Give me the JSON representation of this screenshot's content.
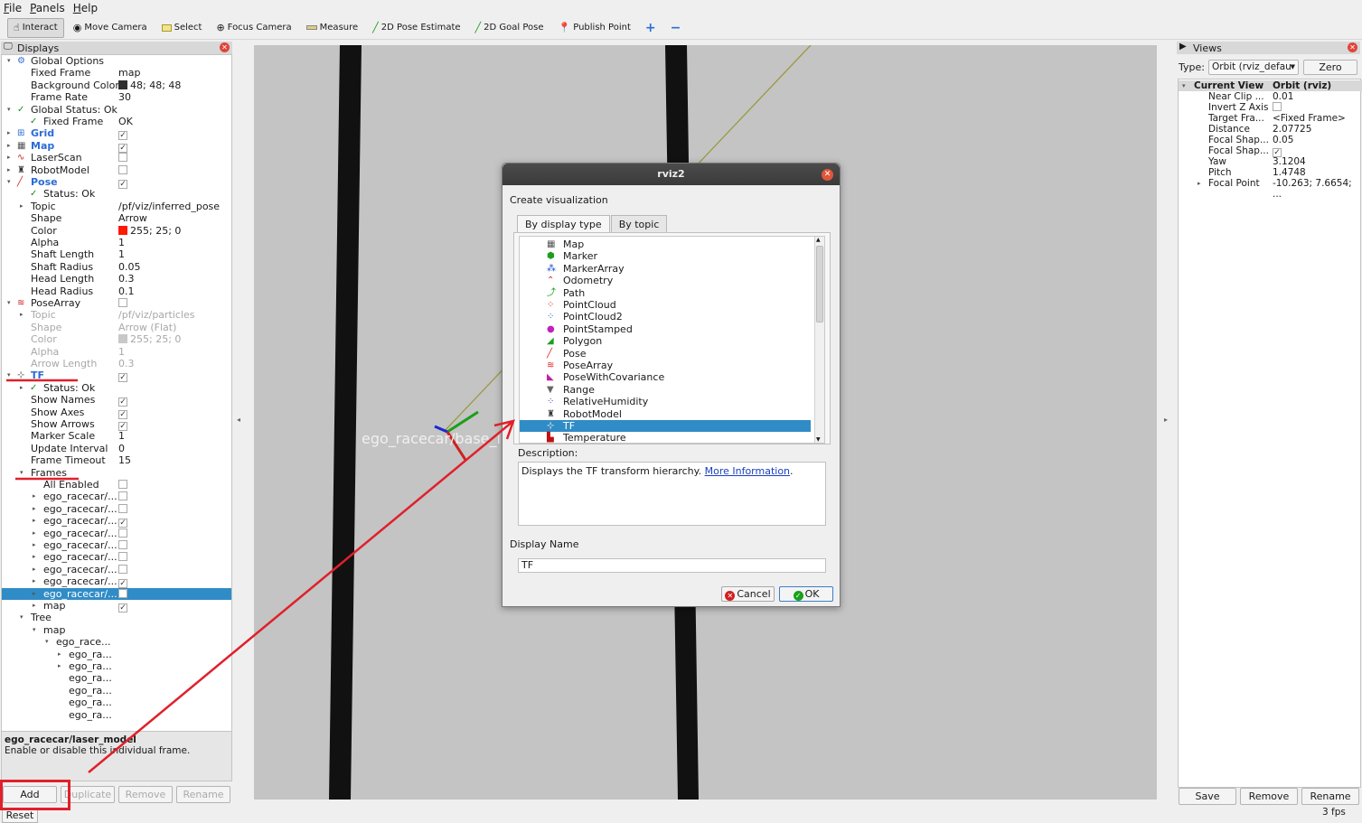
{
  "menubar": [
    "File",
    "Panels",
    "Help"
  ],
  "toolbar": [
    {
      "label": "Interact",
      "icon": "hand-icon",
      "active": true
    },
    {
      "label": "Move Camera",
      "icon": "camera-icon"
    },
    {
      "label": "Select",
      "icon": "select-icon"
    },
    {
      "label": "Focus Camera",
      "icon": "focus-icon"
    },
    {
      "label": "Measure",
      "icon": "ruler-icon"
    },
    {
      "label": "2D Pose Estimate",
      "icon": "green-arrow-icon"
    },
    {
      "label": "2D Goal Pose",
      "icon": "green-arrow-icon"
    },
    {
      "label": "Publish Point",
      "icon": "pin-icon"
    },
    {
      "label": "+",
      "icon": "plus-icon"
    },
    {
      "label": "−",
      "icon": "minus-icon"
    }
  ],
  "displays": {
    "title": "Displays",
    "rows": [
      {
        "d": 0,
        "exp": "v",
        "name": "Global Options",
        "icon": "gear-icon"
      },
      {
        "d": 1,
        "name": "Fixed Frame",
        "val": "map"
      },
      {
        "d": 1,
        "name": "Background Color",
        "val": "48; 48; 48",
        "swatch": "#303030"
      },
      {
        "d": 1,
        "name": "Frame Rate",
        "val": "30"
      },
      {
        "d": 0,
        "exp": "v",
        "name": "Global Status: Ok",
        "icon": "check-icon"
      },
      {
        "d": 1,
        "name": "Fixed Frame",
        "val": "OK",
        "icon": "check-icon"
      },
      {
        "d": 0,
        "exp": ">",
        "name": "Grid",
        "blue": true,
        "chk": true,
        "icon": "grid-icon"
      },
      {
        "d": 0,
        "exp": ">",
        "name": "Map",
        "blue": true,
        "chk": true,
        "icon": "map-icon"
      },
      {
        "d": 0,
        "exp": ">",
        "name": "LaserScan",
        "chk": false,
        "icon": "laserscan-icon"
      },
      {
        "d": 0,
        "exp": ">",
        "name": "RobotModel",
        "chk": false,
        "icon": "robot-icon"
      },
      {
        "d": 0,
        "exp": "v",
        "name": "Pose",
        "blue": true,
        "chk": true,
        "icon": "pose-icon"
      },
      {
        "d": 1,
        "name": "Status: Ok",
        "icon": "check-icon"
      },
      {
        "d": 1,
        "exp": ">",
        "name": "Topic",
        "val": "/pf/viz/inferred_pose"
      },
      {
        "d": 1,
        "name": "Shape",
        "val": "Arrow"
      },
      {
        "d": 1,
        "name": "Color",
        "val": "255; 25; 0",
        "swatch": "#ff1900"
      },
      {
        "d": 1,
        "name": "Alpha",
        "val": "1"
      },
      {
        "d": 1,
        "name": "Shaft Length",
        "val": "1"
      },
      {
        "d": 1,
        "name": "Shaft Radius",
        "val": "0.05"
      },
      {
        "d": 1,
        "name": "Head Length",
        "val": "0.3"
      },
      {
        "d": 1,
        "name": "Head Radius",
        "val": "0.1"
      },
      {
        "d": 0,
        "exp": "v",
        "name": "PoseArray",
        "chk": false,
        "icon": "posearray-icon"
      },
      {
        "d": 1,
        "exp": ">",
        "name": "Topic",
        "val": "/pf/viz/particles",
        "grey": true
      },
      {
        "d": 1,
        "name": "Shape",
        "val": "Arrow (Flat)",
        "grey": true
      },
      {
        "d": 1,
        "name": "Color",
        "val": "255; 25; 0",
        "swatch": "#c8c8c8",
        "grey": true
      },
      {
        "d": 1,
        "name": "Alpha",
        "val": "1",
        "grey": true
      },
      {
        "d": 1,
        "name": "Arrow Length",
        "val": "0.3",
        "grey": true
      },
      {
        "d": 0,
        "exp": "v",
        "name": "TF",
        "blue": true,
        "chk": true,
        "icon": "tf-icon"
      },
      {
        "d": 1,
        "exp": ">",
        "name": "Status: Ok",
        "icon": "check-icon"
      },
      {
        "d": 1,
        "name": "Show Names",
        "chk": true
      },
      {
        "d": 1,
        "name": "Show Axes",
        "chk": true
      },
      {
        "d": 1,
        "name": "Show Arrows",
        "chk": true
      },
      {
        "d": 1,
        "name": "Marker Scale",
        "val": "1"
      },
      {
        "d": 1,
        "name": "Update Interval",
        "val": "0"
      },
      {
        "d": 1,
        "name": "Frame Timeout",
        "val": "15"
      },
      {
        "d": 1,
        "exp": "v",
        "name": "Frames"
      },
      {
        "d": 2,
        "name": "All Enabled",
        "chk": false
      },
      {
        "d": 2,
        "exp": ">",
        "name": "ego_racecar/...",
        "chk": false
      },
      {
        "d": 2,
        "exp": ">",
        "name": "ego_racecar/...",
        "chk": false
      },
      {
        "d": 2,
        "exp": ">",
        "name": "ego_racecar/...",
        "chk": true
      },
      {
        "d": 2,
        "exp": ">",
        "name": "ego_racecar/...",
        "chk": false
      },
      {
        "d": 2,
        "exp": ">",
        "name": "ego_racecar/...",
        "chk": false
      },
      {
        "d": 2,
        "exp": ">",
        "name": "ego_racecar/...",
        "chk": false
      },
      {
        "d": 2,
        "exp": ">",
        "name": "ego_racecar/...",
        "chk": false
      },
      {
        "d": 2,
        "exp": ">",
        "name": "ego_racecar/...",
        "chk": true
      },
      {
        "d": 2,
        "exp": ">",
        "name": "ego_racecar/...",
        "chk": false,
        "sel": true
      },
      {
        "d": 2,
        "exp": ">",
        "name": "map",
        "chk": true
      },
      {
        "d": 1,
        "exp": "v",
        "name": "Tree"
      },
      {
        "d": 2,
        "exp": "v",
        "name": "map"
      },
      {
        "d": 3,
        "exp": "v",
        "name": "ego_race..."
      },
      {
        "d": 4,
        "exp": ">",
        "name": "ego_ra..."
      },
      {
        "d": 4,
        "exp": ">",
        "name": "ego_ra..."
      },
      {
        "d": 4,
        "name": "ego_ra..."
      },
      {
        "d": 4,
        "name": "ego_ra..."
      },
      {
        "d": 4,
        "name": "ego_ra..."
      },
      {
        "d": 4,
        "name": "ego_ra..."
      }
    ],
    "desc_title": "ego_racecar/laser_model",
    "desc_text": "Enable or disable this individual frame.",
    "buttons": {
      "add": "Add",
      "duplicate": "Duplicate",
      "remove": "Remove",
      "rename": "Rename"
    },
    "reset": "Reset"
  },
  "viewport": {
    "frame_label": "ego_racecar/base_link",
    "bg": "#c4c4c4"
  },
  "views": {
    "title": "Views",
    "type_label": "Type:",
    "type_value": "Orbit (rviz_defau",
    "zero": "Zero",
    "header": {
      "name": "Current View",
      "value": "Orbit (rviz)"
    },
    "rows": [
      {
        "name": "Near Clip ...",
        "val": "0.01"
      },
      {
        "name": "Invert Z Axis",
        "chk": false
      },
      {
        "name": "Target Fra...",
        "val": "<Fixed Frame>"
      },
      {
        "name": "Distance",
        "val": "2.07725"
      },
      {
        "name": "Focal Shap...",
        "val": "0.05"
      },
      {
        "name": "Focal Shap...",
        "chk": true
      },
      {
        "name": "Yaw",
        "val": "3.1204"
      },
      {
        "name": "Pitch",
        "val": "1.4748"
      },
      {
        "name": "Focal Point",
        "val": "-10.263; 7.6654; ...",
        "exp": true
      }
    ],
    "buttons": {
      "save": "Save",
      "remove": "Remove",
      "rename": "Rename"
    },
    "fps": "3 fps"
  },
  "dialog": {
    "title": "rviz2",
    "heading": "Create visualization",
    "tabs": [
      "By display type",
      "By topic"
    ],
    "items": [
      {
        "label": "Map",
        "icon": "map-icon",
        "color": "#555"
      },
      {
        "label": "Marker",
        "icon": "marker-icon",
        "color": "#1aa01a"
      },
      {
        "label": "MarkerArray",
        "icon": "markerarray-icon",
        "color": "#1a4ad0"
      },
      {
        "label": "Odometry",
        "icon": "odometry-icon",
        "color": "#e02020"
      },
      {
        "label": "Path",
        "icon": "path-icon",
        "color": "#1aa01a"
      },
      {
        "label": "PointCloud",
        "icon": "pointcloud-icon",
        "color": "#e02020"
      },
      {
        "label": "PointCloud2",
        "icon": "pointcloud2-icon",
        "color": "#2a6cd6"
      },
      {
        "label": "PointStamped",
        "icon": "pointstamped-icon",
        "color": "#c020c0"
      },
      {
        "label": "Polygon",
        "icon": "polygon-icon",
        "color": "#1aa01a"
      },
      {
        "label": "Pose",
        "icon": "pose-icon",
        "color": "#e02020"
      },
      {
        "label": "PoseArray",
        "icon": "posearray-icon",
        "color": "#e02020"
      },
      {
        "label": "PoseWithCovariance",
        "icon": "posecov-icon",
        "color": "#c020a0"
      },
      {
        "label": "Range",
        "icon": "range-icon",
        "color": "#666"
      },
      {
        "label": "RelativeHumidity",
        "icon": "humidity-icon",
        "color": "#7030c0"
      },
      {
        "label": "RobotModel",
        "icon": "robot-icon",
        "color": "#333"
      },
      {
        "label": "TF",
        "icon": "tf-icon",
        "color": "#fff",
        "sel": true
      },
      {
        "label": "Temperature",
        "icon": "temperature-icon",
        "color": "#c01010"
      }
    ],
    "desc_label": "Description:",
    "desc_text": "Displays the TF transform hierarchy.",
    "desc_link": "More Information",
    "name_label": "Display Name",
    "name_value": "TF",
    "cancel": "Cancel",
    "ok": "OK"
  },
  "colors": {
    "selection": "#308cc6",
    "annotation": "#e0202a"
  }
}
